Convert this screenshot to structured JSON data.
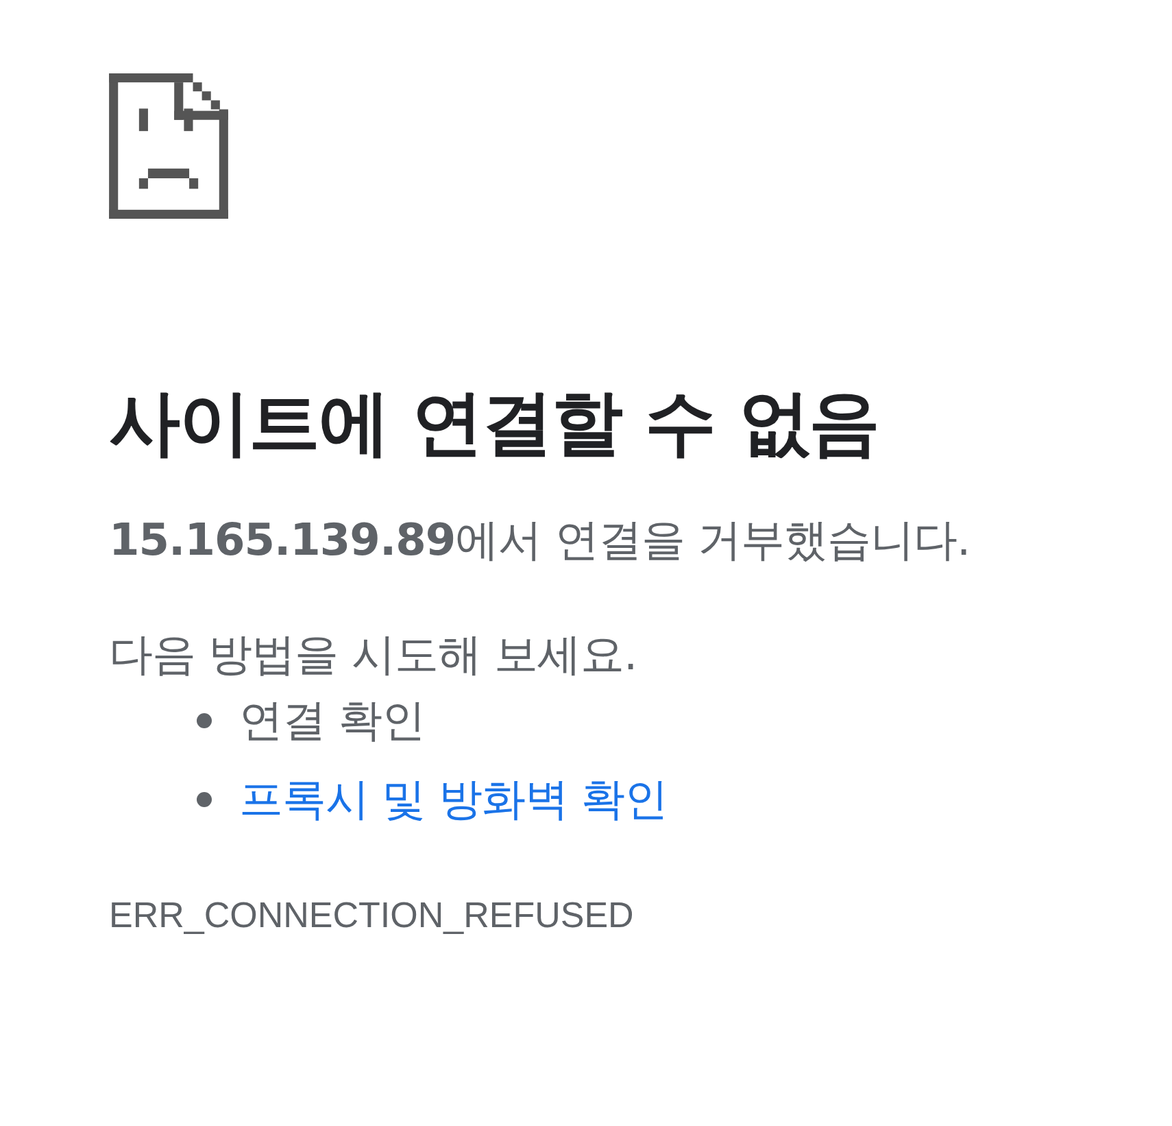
{
  "heading": "사이트에 연결할 수 없음",
  "summary": "**15.165.139.89**에서 연결을 거부했습니다.",
  "suggestions_intro": "다음 방법을 시도해 보세요.",
  "suggestions": [
    {
      "kind": "text",
      "label": "연결 확인"
    },
    {
      "kind": "link",
      "label": "프록시 및 방화벽 확인"
    }
  ],
  "error_code": "ERR_CONNECTION_REFUSED"
}
